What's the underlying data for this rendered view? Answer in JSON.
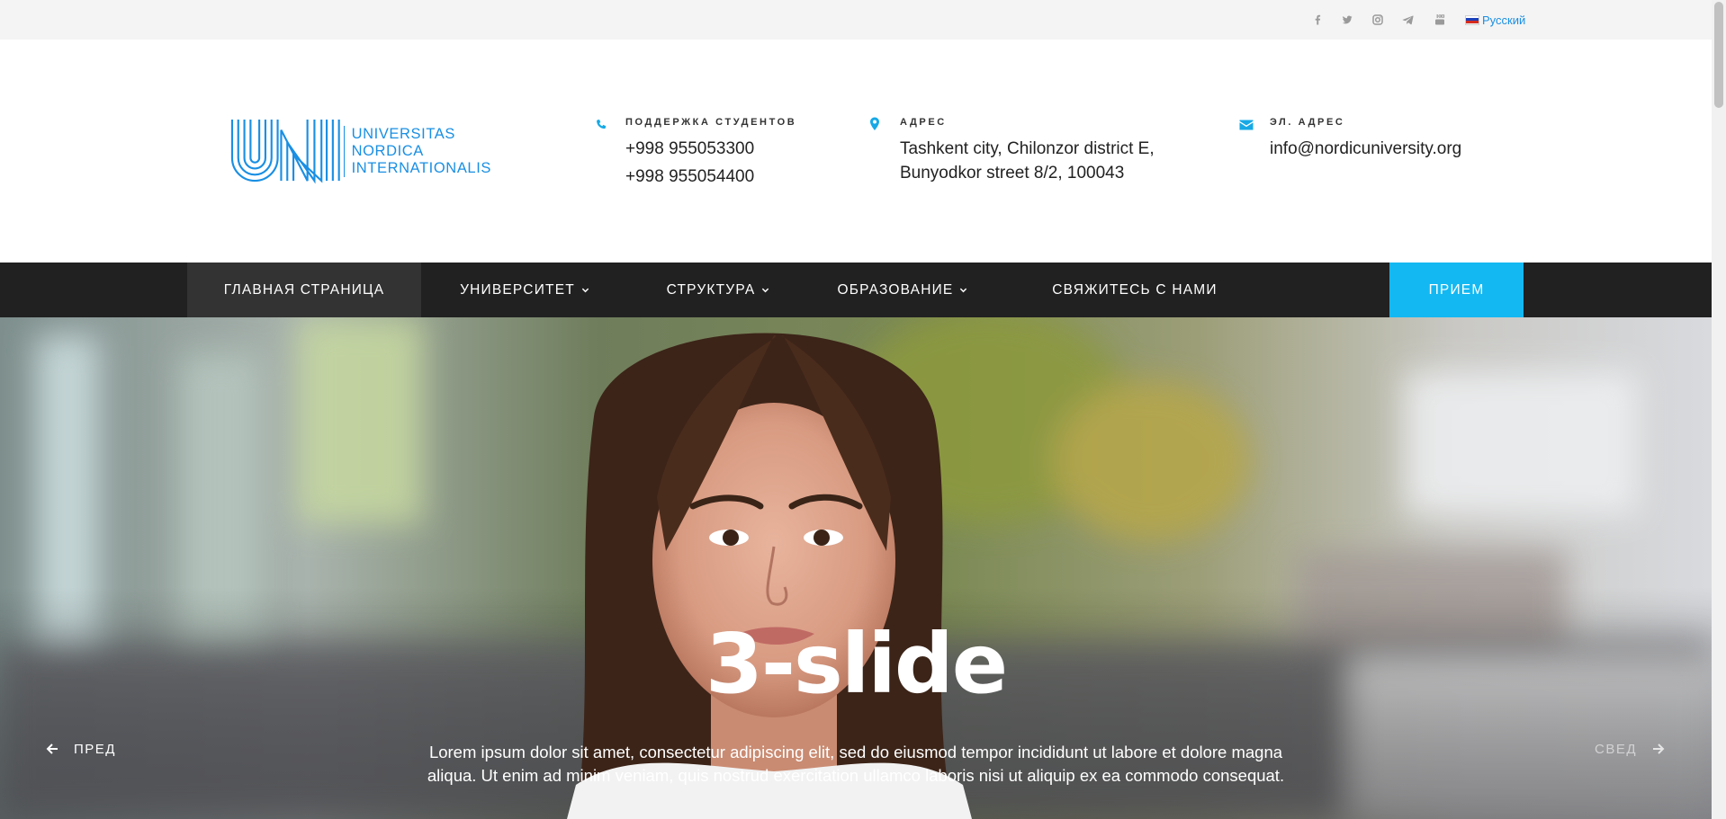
{
  "topbar": {
    "social": [
      {
        "icon": "facebook-icon"
      },
      {
        "icon": "twitter-icon"
      },
      {
        "icon": "instagram-icon"
      },
      {
        "icon": "telegram-icon"
      },
      {
        "icon": "youtube-icon"
      }
    ],
    "language": {
      "label": "Русский",
      "flag_colors": [
        "#ffffff",
        "#1c3fb8",
        "#d52b1e"
      ]
    }
  },
  "header": {
    "logo": {
      "mark": "UNI",
      "lines": [
        "UNIVERSITAS",
        "NORDICA",
        "INTERNATIONALIS"
      ]
    },
    "support": {
      "label": "ПОДДЕРЖКА СТУДЕНТОВ",
      "phones": [
        "+998 955053300",
        "+998 955054400"
      ]
    },
    "address": {
      "label": "АДРЕС",
      "lines": [
        "Tashkent city, Chilonzor district E,",
        "Bunyodkor street 8/2, 100043"
      ]
    },
    "email": {
      "label": "ЭЛ. АДРЕС",
      "value": "info@nordicuniversity.org"
    }
  },
  "nav": {
    "items": [
      {
        "label": "ГЛАВНАЯ СТРАНИЦА",
        "active": true,
        "dropdown": false
      },
      {
        "label": "УНИВЕРСИТЕТ",
        "active": false,
        "dropdown": true
      },
      {
        "label": "СТРУКТУРА",
        "active": false,
        "dropdown": true
      },
      {
        "label": "ОБРАЗОВАНИЕ",
        "active": false,
        "dropdown": true
      },
      {
        "label": "СВЯЖИТЕСЬ С НАМИ",
        "active": false,
        "dropdown": false
      }
    ],
    "cta": "ПРИЕМ"
  },
  "hero": {
    "title": "3-slide",
    "text": "Lorem ipsum dolor sit amet, consectetur adipiscing elit, sed do eiusmod tempor incididunt ut labore et dolore magna aliqua. Ut enim ad minim veniam, quis nostrud exercitation ullamco laboris nisi ut aliquip ex ea commodo consequat.",
    "prev_label": "ПРЕД",
    "next_label": "СВЕД"
  },
  "colors": {
    "accent": "#13b8f2",
    "brand_blue": "#1a8fe3",
    "nav_bg": "#212121",
    "nav_active_bg": "#333333",
    "topbar_bg": "#f4f4f4"
  }
}
